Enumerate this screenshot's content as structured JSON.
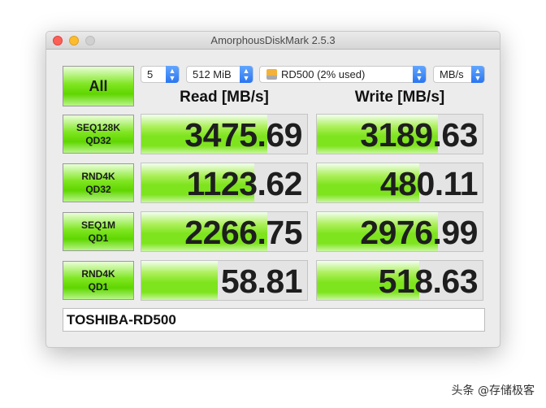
{
  "window": {
    "title": "AmorphousDiskMark 2.5.3"
  },
  "controls": {
    "all_label": "All",
    "count": "5",
    "size": "512 MiB",
    "drive": "RD500 (2% used)",
    "unit": "MB/s"
  },
  "headers": {
    "read": "Read [MB/s]",
    "write": "Write [MB/s]"
  },
  "rows": [
    {
      "line1": "SEQ128K",
      "line2": "QD32",
      "read": "3475.69",
      "write": "3189.63",
      "read_fill": 0.76,
      "write_fill": 0.73
    },
    {
      "line1": "RND4K",
      "line2": "QD32",
      "read": "1123.62",
      "write": "480.11",
      "read_fill": 0.68,
      "write_fill": 0.62
    },
    {
      "line1": "SEQ1M",
      "line2": "QD1",
      "read": "2266.75",
      "write": "2976.99",
      "read_fill": 0.76,
      "write_fill": 0.73
    },
    {
      "line1": "RND4K",
      "line2": "QD1",
      "read": "58.81",
      "write": "518.63",
      "read_fill": 0.46,
      "write_fill": 0.62
    }
  ],
  "device_name": "TOSHIBA-RD500",
  "watermark": "头条 @存储极客"
}
